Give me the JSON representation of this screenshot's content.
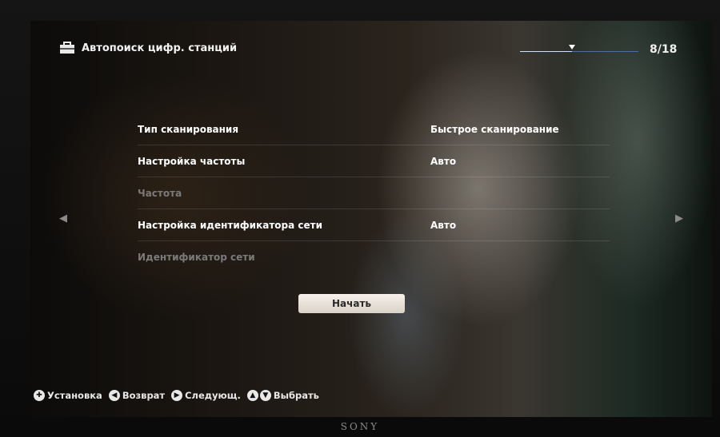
{
  "header": {
    "title": "Автопоиск цифр. станций",
    "page_counter": "8/18",
    "progress_fraction": 0.44,
    "icon": "toolbox-icon"
  },
  "settings": [
    {
      "label": "Тип сканирования",
      "value": "Быстрое сканирование",
      "enabled": true
    },
    {
      "label": "Настройка частоты",
      "value": "Авто",
      "enabled": true
    },
    {
      "label": "Частота",
      "value": "",
      "enabled": false
    },
    {
      "label": "Настройка идентификатора сети",
      "value": "Авто",
      "enabled": true
    },
    {
      "label": "Идентификатор сети",
      "value": "",
      "enabled": false
    }
  ],
  "start_button": {
    "label": "Начать"
  },
  "footer": {
    "hints": [
      {
        "label": "Установка",
        "icon": "dpad-icon"
      },
      {
        "label": "Возврат",
        "icon": "left-arrow-icon"
      },
      {
        "label": "Следующ.",
        "icon": "right-arrow-icon"
      },
      {
        "label": "Выбрать",
        "icon": "up-down-arrow-icon"
      }
    ]
  },
  "brand": "SONY",
  "colors": {
    "progress_track": "#4a6fa8",
    "button_bg": "#f0eae2",
    "disabled_text": "#7a7a7a"
  }
}
